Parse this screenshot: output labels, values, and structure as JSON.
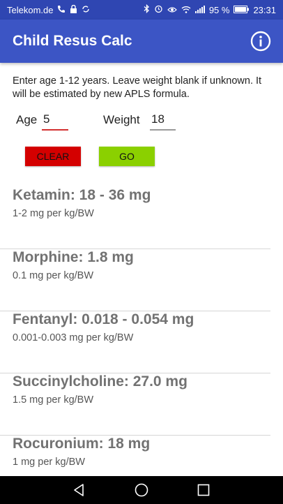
{
  "status_bar": {
    "carrier": "Telekom.de",
    "battery": "95 %",
    "time": "23:31",
    "icons": [
      "phone-icon",
      "lock-icon",
      "sync-icon",
      "bluetooth-icon",
      "alarm-icon",
      "eye-icon",
      "wifi-icon",
      "signal-icon",
      "battery-icon"
    ]
  },
  "app_bar": {
    "title": "Child Resus Calc",
    "info_icon": "info-icon"
  },
  "form": {
    "instructions": "Enter age 1-12 years. Leave weight blank if unknown. It will be estimated by new APLS formula.",
    "age_label": "Age",
    "age_value": "5",
    "weight_label": "Weight",
    "weight_value": "18",
    "clear_label": "CLEAR",
    "go_label": "GO"
  },
  "colors": {
    "app_bar": "#3c55c5",
    "status_bar": "#2f46b2",
    "clear_button": "#d40000",
    "go_button": "#8bd000",
    "active_underline": "#d32f2f"
  },
  "drugs": [
    {
      "title": "Ketamin: 18 - 36 mg",
      "dose": "1-2 mg per kg/BW"
    },
    {
      "title": "Morphine: 1.8 mg",
      "dose": "0.1 mg per kg/BW"
    },
    {
      "title": "Fentanyl: 0.018 - 0.054 mg",
      "dose": "0.001-0.003 mg per kg/BW"
    },
    {
      "title": "Succinylcholine: 27.0 mg",
      "dose": "1.5 mg per kg/BW"
    },
    {
      "title": "Rocuronium: 18 mg",
      "dose": "1 mg per kg/BW"
    }
  ],
  "nav_bar": {
    "icons": [
      "back-icon",
      "home-icon",
      "recents-icon"
    ]
  }
}
